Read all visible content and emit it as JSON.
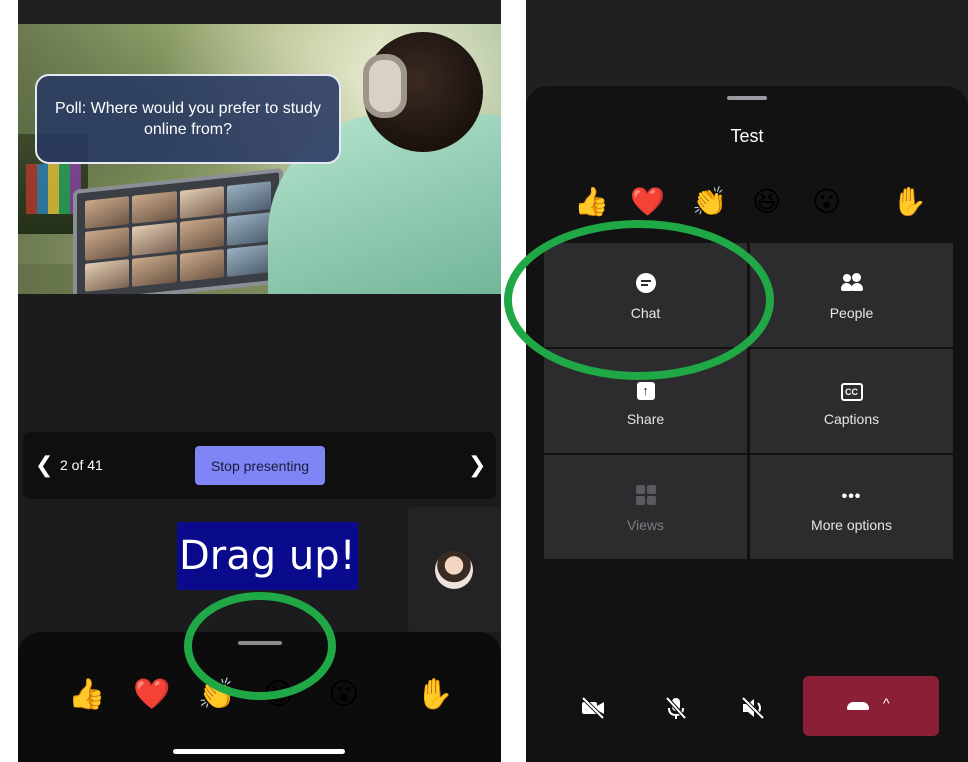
{
  "left_screen": {
    "poll_text": "Poll: Where would you prefer to study online from?",
    "slide_counter": "2 of 41",
    "stop_presenting_label": "Stop presenting",
    "prev_icon": "chevron-left-icon",
    "next_icon": "chevron-right-icon",
    "drag_hint": "Drag up!",
    "reactions": [
      "👍",
      "❤️",
      "👏",
      "😆",
      "😮",
      "✋"
    ]
  },
  "right_screen": {
    "title": "Test",
    "reactions": [
      "👍",
      "❤️",
      "👏",
      "😆",
      "😮",
      "✋"
    ],
    "tiles": [
      {
        "label": "Chat",
        "icon": "chat-icon",
        "enabled": true
      },
      {
        "label": "People",
        "icon": "people-icon",
        "enabled": true
      },
      {
        "label": "Share",
        "icon": "share-icon",
        "enabled": true
      },
      {
        "label": "Captions",
        "icon": "captions-icon",
        "enabled": true
      },
      {
        "label": "Views",
        "icon": "views-icon",
        "enabled": false
      },
      {
        "label": "More options",
        "icon": "more-options-icon",
        "enabled": true
      }
    ],
    "controls": {
      "camera_icon": "camera-off-icon",
      "mic_icon": "mic-off-icon",
      "speaker_icon": "speaker-off-icon",
      "leave_icon": "hang-up-icon",
      "leave_caret": "^"
    }
  },
  "annotation": {
    "ring_color": "#1fa845",
    "drag_hint_background": "#0a0a8c"
  },
  "colors": {
    "stop_presenting": "#7f85f5",
    "leave_button": "#8a1f36"
  }
}
